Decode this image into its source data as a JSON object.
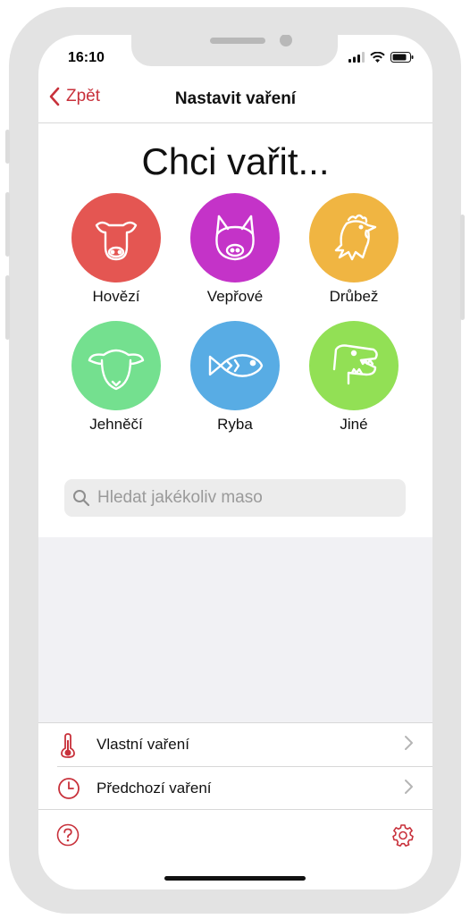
{
  "status": {
    "time": "16:10"
  },
  "nav": {
    "back_label": "Zpět",
    "title": "Nastavit vaření"
  },
  "heading": "Chci vařit...",
  "categories": [
    {
      "label": "Hovězí",
      "color": "#e45652",
      "icon": "cow-icon"
    },
    {
      "label": "Vepřové",
      "color": "#c433c8",
      "icon": "pig-icon"
    },
    {
      "label": "Drůbež",
      "color": "#f0b542",
      "icon": "chicken-icon"
    },
    {
      "label": "Jehněčí",
      "color": "#74e08f",
      "icon": "sheep-icon"
    },
    {
      "label": "Ryba",
      "color": "#58ace4",
      "icon": "fish-icon"
    },
    {
      "label": "Jiné",
      "color": "#92e055",
      "icon": "dinosaur-icon"
    }
  ],
  "search": {
    "placeholder": "Hledat jakékoliv maso"
  },
  "menu": [
    {
      "label": "Vlastní vaření",
      "icon": "thermometer-icon"
    },
    {
      "label": "Předchozí vaření",
      "icon": "clock-icon"
    }
  ],
  "toolbar": {
    "help_icon": "help-icon",
    "settings_icon": "gear-icon"
  },
  "colors": {
    "accent": "#c8313b"
  }
}
